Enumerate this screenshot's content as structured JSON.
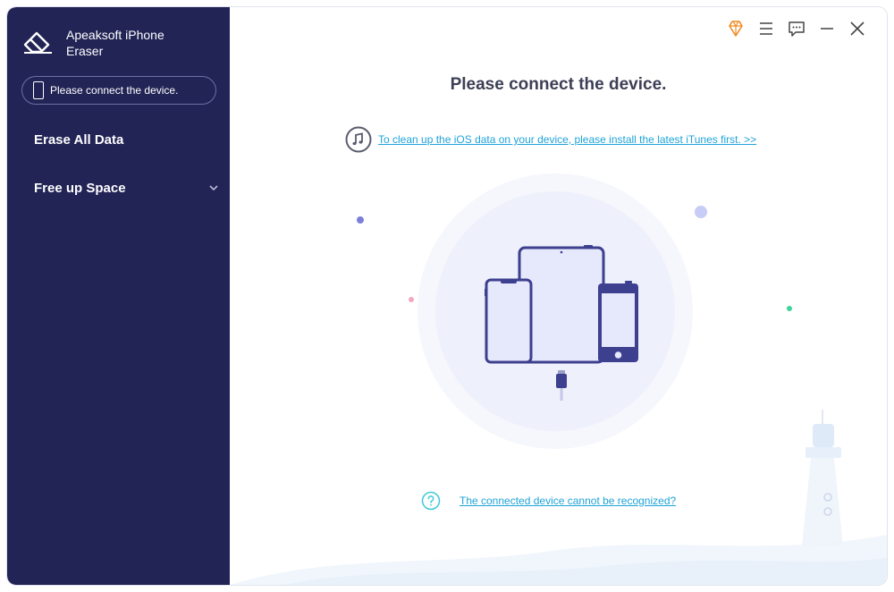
{
  "app": {
    "title": "Apeaksoft iPhone Eraser"
  },
  "sidebar": {
    "device_status": "Please connect the device.",
    "items": [
      {
        "label": "Erase All Data"
      },
      {
        "label": "Free up Space"
      }
    ]
  },
  "titlebar": {
    "icons": [
      "diamond-icon",
      "menu-icon",
      "feedback-icon",
      "minimize-icon",
      "close-icon"
    ]
  },
  "main": {
    "title": "Please connect the device.",
    "itunes_link": "To clean up the iOS data on your device, please install the latest iTunes first. >>",
    "help_link": "The connected device cannot be recognized?"
  },
  "colors": {
    "sidebar_bg": "#222456",
    "accent_link": "#1fa3d8",
    "device_fill": "#e8eafb",
    "device_stroke": "#3d3f8f",
    "premium": "#f08a24"
  }
}
